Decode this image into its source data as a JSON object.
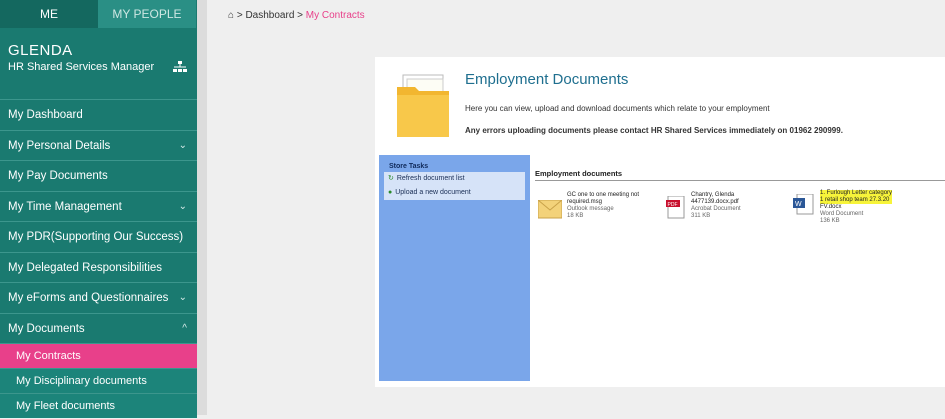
{
  "sidebar": {
    "tabs": [
      "ME",
      "MY PEOPLE"
    ],
    "user_name": "GLENDA",
    "user_role": "HR Shared Services Manager",
    "items": [
      {
        "label": "My Dashboard",
        "chevron": ""
      },
      {
        "label": "My Personal Details",
        "chevron": "⌄"
      },
      {
        "label": "My Pay Documents",
        "chevron": ""
      },
      {
        "label": "My Time Management",
        "chevron": "⌄"
      },
      {
        "label": "My PDR(Supporting Our Success)",
        "chevron": ""
      },
      {
        "label": "My Delegated Responsibilities",
        "chevron": ""
      },
      {
        "label": "My eForms and Questionnaires",
        "chevron": "⌄"
      },
      {
        "label": "My Documents",
        "chevron": "^"
      }
    ],
    "sub_items": [
      "My Contracts",
      "My Disciplinary documents",
      "My Fleet documents"
    ]
  },
  "breadcrumb": {
    "home": "Dashboard",
    "separator": ">",
    "current": "My Contracts"
  },
  "employment": {
    "title": "Employment Documents",
    "description": "Here you can view, upload and download documents which relate to your employment",
    "errors": "Any errors uploading documents please contact HR Shared Services immediately on 01962 290999."
  },
  "tasks": {
    "title": "Store Tasks",
    "items": [
      "Refresh document list",
      "Upload a new document"
    ]
  },
  "documents": {
    "title": "Employment documents",
    "files": [
      {
        "name1": "GC one to one meeting not",
        "name2": "required.msg",
        "type": "Outlook message",
        "size": "18 KB",
        "icon": "envelope-icon"
      },
      {
        "name1": "Chantry, Glenda",
        "name2": "4477139.docx.pdf",
        "type": "Acrobat Document",
        "size": "311 KB",
        "icon": "pdf-icon"
      },
      {
        "name1": "1. Furlough Letter category",
        "name2": "1 retail shop team 27.3.20",
        "name3": "FV.docx",
        "type": "Word Document",
        "size": "136 KB",
        "icon": "word-icon"
      }
    ]
  },
  "colors": {
    "sidebar": "#1a7a70",
    "accent": "#e8408a",
    "title": "#1f6f8f",
    "tasks": "#7aa6ea"
  }
}
